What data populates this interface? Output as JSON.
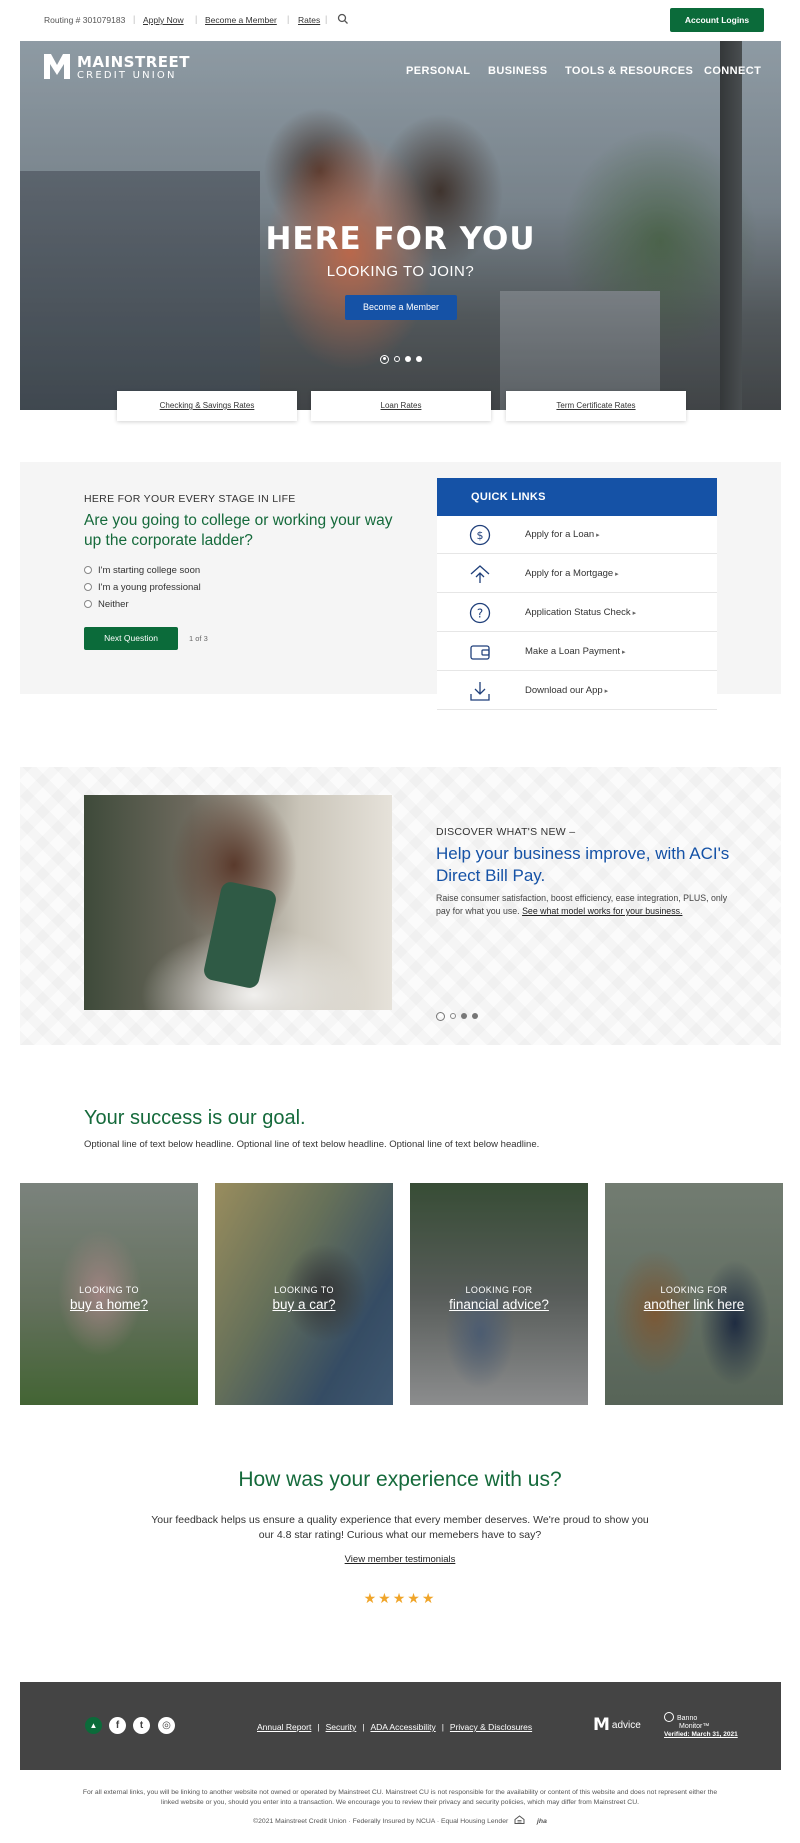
{
  "topbar": {
    "routing": "Routing # 301079183",
    "links": [
      "Apply Now",
      "Become a Member",
      "Rates"
    ],
    "search_icon": "search-icon",
    "account_logins": "Account Logins"
  },
  "logo": {
    "line1": "MAINSTREET",
    "line2": "CREDIT UNION"
  },
  "nav": [
    "PERSONAL",
    "BUSINESS",
    "TOOLS & RESOURCES",
    "CONNECT"
  ],
  "hero": {
    "title": "HERE FOR YOU",
    "subtitle": "LOOKING TO JOIN?",
    "cta": "Become a Member",
    "slide_count": 4,
    "active_slide": 1
  },
  "rates": [
    "Checking & Savings Rates",
    "Loan Rates",
    "Term Certificate Rates"
  ],
  "stage": {
    "eyebrow": "HERE FOR YOUR EVERY STAGE IN LIFE",
    "question": "Are you going to college or working your way up the corporate ladder?",
    "options": [
      "I'm starting college soon",
      "I'm a young professional",
      "Neither"
    ],
    "next_button": "Next Question",
    "progress": "1 of 3"
  },
  "quick_links": {
    "header": "QUICK LINKS",
    "items": [
      {
        "label": "Apply for a Loan",
        "icon": "dollar-circle-icon"
      },
      {
        "label": "Apply for a Mortgage",
        "icon": "house-arrow-icon"
      },
      {
        "label": "Application Status Check",
        "icon": "question-circle-icon"
      },
      {
        "label": "Make a Loan Payment",
        "icon": "wallet-icon"
      },
      {
        "label": "Download our App",
        "icon": "download-icon"
      }
    ]
  },
  "discover": {
    "eyebrow": "DISCOVER WHAT'S NEW –",
    "title": "Help your business improve, with ACI's Direct Bill Pay.",
    "body": "Raise consumer satisfaction, boost efficiency, ease integration, PLUS, only pay for what you use. ",
    "link": "See what model works for your business.",
    "slide_count": 4
  },
  "success": {
    "title": "Your success is our goal.",
    "subtitle": "Optional line of text below headline. Optional line of text below headline. Optional line of text below headline.",
    "tiles": [
      {
        "eyebrow": "LOOKING TO",
        "link": "buy a home?"
      },
      {
        "eyebrow": "LOOKING TO",
        "link": "buy a car?"
      },
      {
        "eyebrow": "LOOKING FOR",
        "link": "financial advice?"
      },
      {
        "eyebrow": "LOOKING FOR",
        "link": "another link here"
      }
    ]
  },
  "experience": {
    "title": "How was your experience with us?",
    "body": "Your feedback helps us ensure a quality experience that every member deserves. We're proud to show you our 4.8 star rating! Curious what our memebers have to say?",
    "link": "View member testimonials",
    "stars": "★★★★★",
    "rating": 4.8
  },
  "footer": {
    "links": [
      "Annual Report",
      "Security",
      "ADA Accessibility",
      "Privacy & Disclosures"
    ],
    "advice": "advice",
    "advice_mark": "M",
    "banno_line1": "Banno",
    "banno_line2": "Monitor™",
    "banno_verified": "Verified: March 31, 2021",
    "disclaimer": "For all external links, you will be linking to another website not owned or operated by Mainstreet CU. Mainstreet CU is not responsible for the availability or content of this website and does not represent either the linked website or you, should you enter into a transaction. We encourage you to review their privacy and security policies, which may differ from Mainstreet CU.",
    "legal": "©2021 Mainstreet Credit Union  ·  Federally Insured by NCUA  ·  Equal Housing Lender",
    "jha": "jha"
  },
  "colors": {
    "brand_green": "#0b6b3a",
    "brand_blue": "#1552a6",
    "star": "#f0a52a",
    "footer_bg": "#444444"
  }
}
